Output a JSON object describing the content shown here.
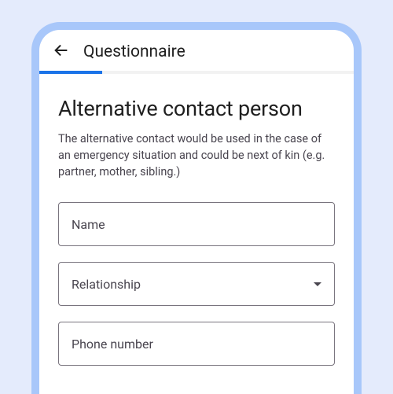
{
  "appBar": {
    "title": "Questionnaire"
  },
  "progress": {
    "percent": 20
  },
  "section": {
    "title": "Alternative contact person",
    "description": "The alternative contact would be used in the case of an emergency situation and could be next of kin (e.g. partner, mother, sibling.)"
  },
  "fields": {
    "name": {
      "label": "Name"
    },
    "relationship": {
      "label": "Relationship"
    },
    "phone": {
      "label": "Phone number"
    }
  }
}
